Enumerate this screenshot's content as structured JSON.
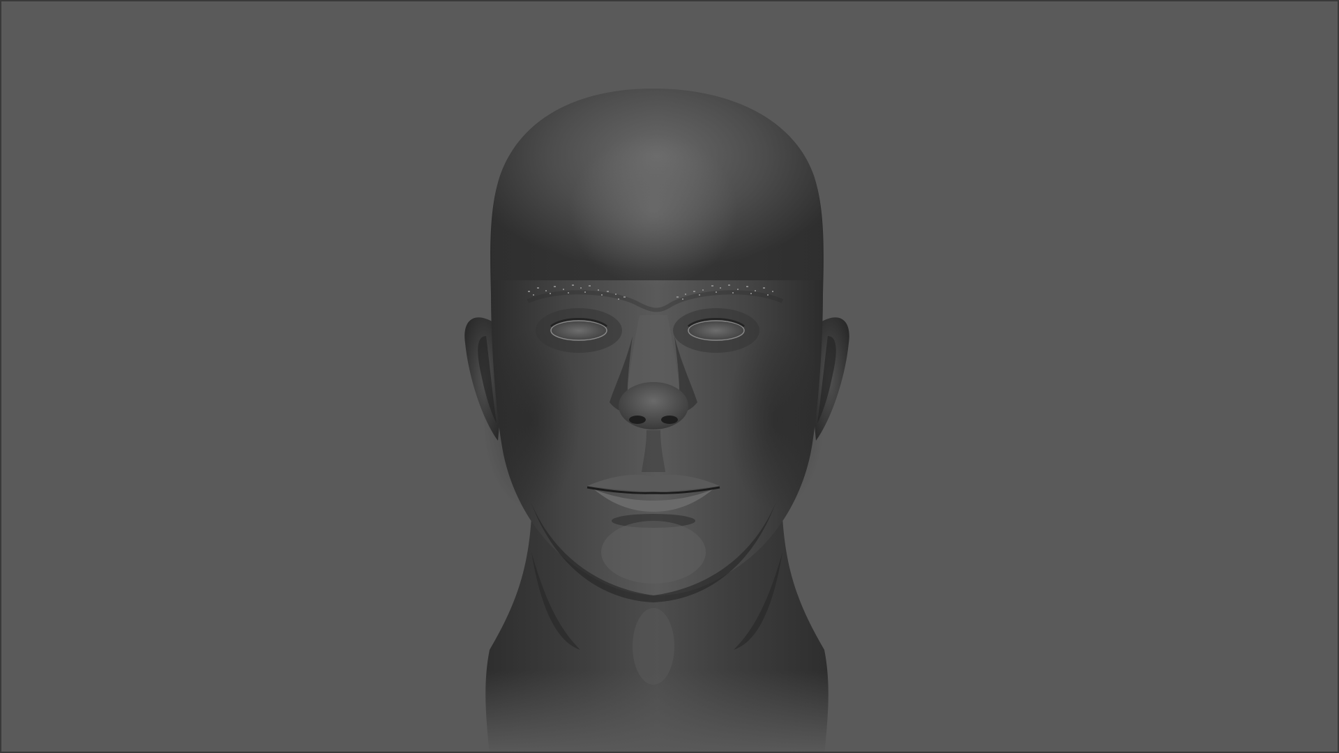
{
  "viewport": {
    "background_color": "#5a5a5a",
    "model_base_color": "#4a4a4a",
    "model_highlight_color": "#727272",
    "model_shadow_color": "#2e2e2e",
    "subject": "head-bust-model"
  }
}
